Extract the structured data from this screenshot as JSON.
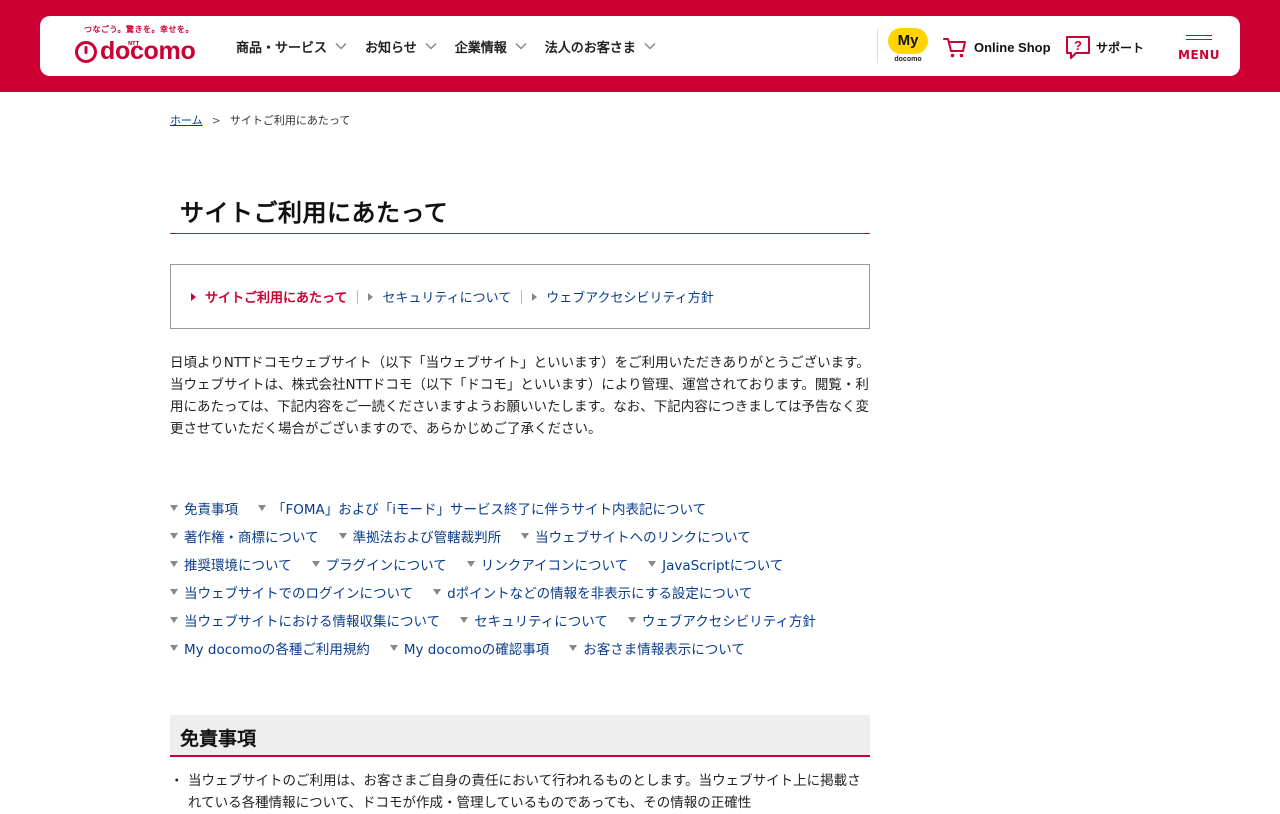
{
  "header": {
    "logo_tagline": "つなごう。驚きを。幸せを。",
    "logo_ntt": "NTT",
    "logo_word": "docomo",
    "nav": [
      {
        "label": "商品・サービス"
      },
      {
        "label": "お知らせ"
      },
      {
        "label": "企業情報"
      },
      {
        "label": "法人のお客さま"
      }
    ],
    "mydocomo_badge": "My",
    "mydocomo_sub": "docomo",
    "online_shop_label": "Online Shop",
    "support_label": "サポート",
    "menu_label": "MENU"
  },
  "breadcrumb": {
    "home": "ホーム",
    "separator": ">",
    "current": "サイトご利用にあたって"
  },
  "page_title": "サイトご利用にあたって",
  "local_nav": [
    {
      "label": "サイトご利用にあたって",
      "current": true
    },
    {
      "label": "セキュリティについて",
      "current": false
    },
    {
      "label": "ウェブアクセシビリティ方針",
      "current": false
    }
  ],
  "intro": {
    "p1": "日頃よりNTTドコモウェブサイト（以下「当ウェブサイト」といいます）をご利用いただきありがとうございます。",
    "p2": "当ウェブサイトは、株式会社NTTドコモ（以下「ドコモ」といいます）により管理、運営されております。閲覧・利用にあたっては、下記内容をご一読くださいますようお願いいたします。なお、下記内容につきましては予告なく変更させていただく場合がございますので、あらかじめご了承ください。"
  },
  "anchor_rows": [
    [
      "免責事項",
      "「FOMA」および「iモード」サービス終了に伴うサイト内表記について"
    ],
    [
      "著作権・商標について",
      "準拠法および管轄裁判所",
      "当ウェブサイトへのリンクについて"
    ],
    [
      "推奨環境について",
      "プラグインについて",
      "リンクアイコンについて",
      "JavaScriptについて"
    ],
    [
      "当ウェブサイトでのログインについて",
      "dポイントなどの情報を非表示にする設定について"
    ],
    [
      "当ウェブサイトにおける情報収集について",
      "セキュリティについて",
      "ウェブアクセシビリティ方針"
    ],
    [
      "My docomoの各種ご利用規約",
      "My docomoの確認事項",
      "お客さま情報表示について"
    ]
  ],
  "section": {
    "heading": "免責事項",
    "item1": "当ウェブサイトのご利用は、お客さまご自身の責任において行われるものとします。当ウェブサイト上に掲載されている各種情報について、ドコモが作成・管理しているものであっても、その情報の正確性"
  },
  "colors": {
    "brand_red": "#cc0033",
    "link_blue": "#0a3c8c",
    "mydocomo_yellow": "#ffd400"
  },
  "icons": {
    "logo_mark": "docomo-ring-icon",
    "nav_chevron": "chevron-down-icon",
    "cart": "cart-icon",
    "support": "question-bubble-icon",
    "menu": "hamburger-icon"
  }
}
